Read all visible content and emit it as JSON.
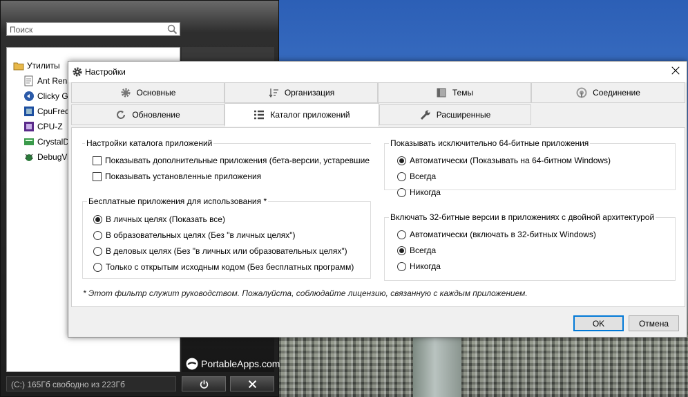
{
  "launcher": {
    "search_placeholder": "Поиск",
    "root_folder": "Утилиты",
    "apps": [
      "Ant Rena",
      "Clicky Go",
      "CpuFreq",
      "CPU-Z",
      "CrystalDi",
      "DebugVi"
    ],
    "logo_text": "PortableApps.com",
    "status": "(C:) 165Гб свободно из 223Гб"
  },
  "dialog": {
    "title": "Настройки",
    "tabs_row1": [
      "Основные",
      "Организация",
      "Темы",
      "Соединение"
    ],
    "tabs_row2": [
      "Обновление",
      "Каталог приложений",
      "Расширенные"
    ],
    "active_tab": "Каталог приложений",
    "catalog_group": {
      "legend": "Настройки каталога приложений",
      "options": [
        {
          "label": "Показывать дополнительные приложения (бета-версии, устаревшие",
          "checked": false
        },
        {
          "label": "Показывать установленные приложения",
          "checked": false
        }
      ]
    },
    "free_group": {
      "legend": "Бесплатные приложения для использования *",
      "options": [
        {
          "label": "В личных целях (Показать все)",
          "selected": true
        },
        {
          "label": "В образовательных целях (Без \"в личных целях\")",
          "selected": false
        },
        {
          "label": "В деловых целях (Без \"в личных или образовательных целях\")",
          "selected": false
        },
        {
          "label": "Только с открытым исходным кодом (Без бесплатных программ)",
          "selected": false
        }
      ]
    },
    "x64_group": {
      "legend": "Показывать исключительно 64-битные приложения",
      "options": [
        {
          "label": "Автоматически (Показывать на 64-битном Windows)",
          "selected": true
        },
        {
          "label": "Всегда",
          "selected": false
        },
        {
          "label": "Никогда",
          "selected": false
        }
      ]
    },
    "x32_group": {
      "legend": "Включать 32-битные версии в приложениях с двойной архитектурой",
      "options": [
        {
          "label": "Автоматически (включать в 32-битных Windows)",
          "selected": false
        },
        {
          "label": "Всегда",
          "selected": true
        },
        {
          "label": "Никогда",
          "selected": false
        }
      ]
    },
    "note": "* Этот фильтр служит руководством. Пожалуйста, соблюдайте лицензию, связанную с каждым приложением.",
    "ok_label": "OK",
    "cancel_label": "Отмена"
  }
}
